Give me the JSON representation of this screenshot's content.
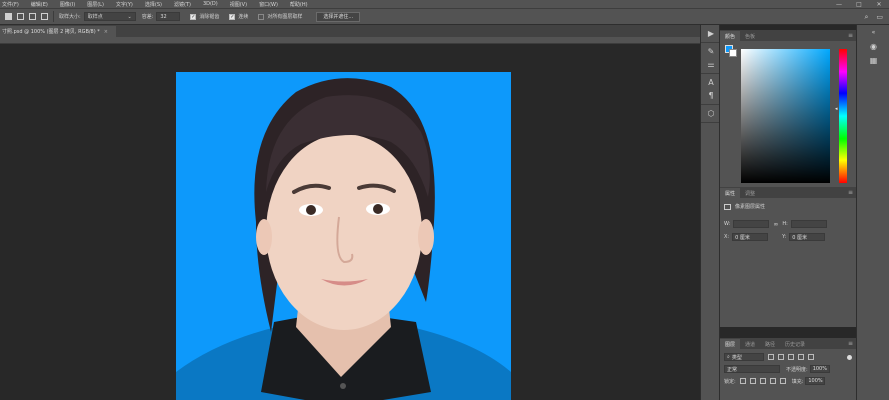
{
  "menu": [
    "文件(F)",
    "编辑(E)",
    "图像(I)",
    "图层(L)",
    "文字(Y)",
    "选择(S)",
    "滤镜(T)",
    "3D(D)",
    "视图(V)",
    "窗口(W)",
    "帮助(H)"
  ],
  "window_controls": [
    "—",
    "□",
    "✕"
  ],
  "options": {
    "sample_size_label": "取样大小:",
    "sample_size_value": "取样点",
    "tolerance_label": "容差:",
    "tolerance_value": "32",
    "anti_alias_label": "消除锯齿",
    "contiguous_label": "连续",
    "sample_all_label": "对所有图层取样",
    "select_subject_label": "选择并遮住..."
  },
  "document_tab": {
    "title": "寸照.psd @ 100% (图层 2 拷贝, RGB/8) *",
    "close": "×"
  },
  "color_panel": {
    "tabs": [
      "颜色",
      "色板"
    ],
    "fg_color": "#0d99fb",
    "bg_color": "#ffffff"
  },
  "properties_panel": {
    "tabs": [
      "属性",
      "调整"
    ],
    "title": "像素图层属性",
    "w_label": "W:",
    "h_label": "H:",
    "x_label": "X:",
    "x_value": "0 厘米",
    "y_label": "Y:",
    "y_value": "0 厘米",
    "link_icon": "link-icon"
  },
  "layers_panel": {
    "tabs": [
      "图层",
      "通道",
      "路径",
      "历史记录"
    ],
    "filter_label": "类型",
    "blend_mode": "正常",
    "opacity_label": "不透明度:",
    "opacity_value": "100%",
    "lock_label": "锁定:",
    "fill_label": "填充:",
    "fill_value": "100%"
  },
  "accent_color": "#0d99fb"
}
